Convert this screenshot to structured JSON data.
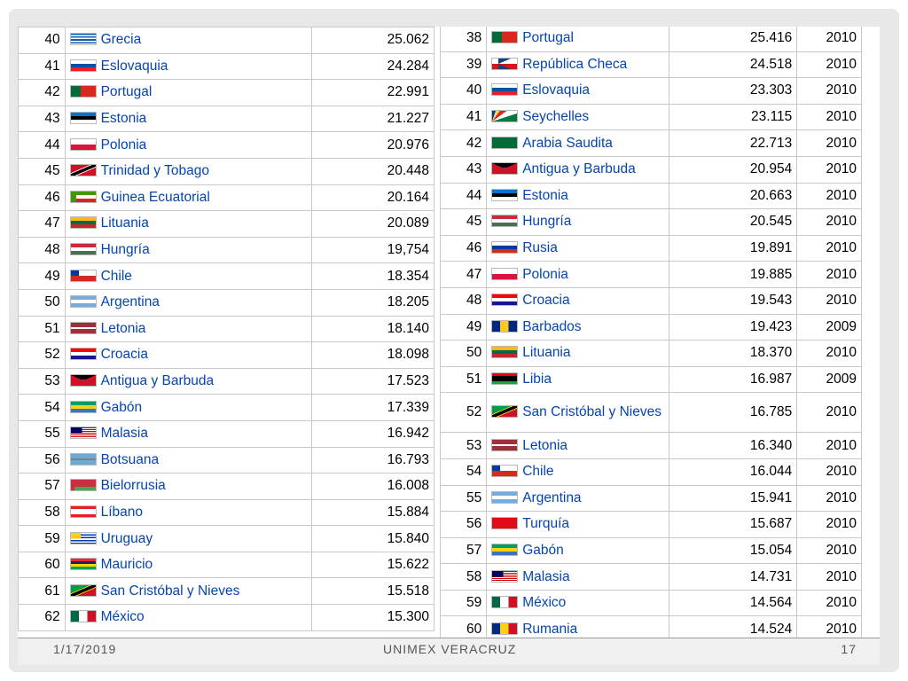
{
  "left_table": {
    "rows": [
      {
        "rank": "40",
        "flag": "gr",
        "country": "Grecia",
        "value": "25.062"
      },
      {
        "rank": "41",
        "flag": "sk",
        "country": "Eslovaquia",
        "value": "24.284"
      },
      {
        "rank": "42",
        "flag": "pt",
        "country": "Portugal",
        "value": "22.991"
      },
      {
        "rank": "43",
        "flag": "ee",
        "country": "Estonia",
        "value": "21.227"
      },
      {
        "rank": "44",
        "flag": "pl",
        "country": "Polonia",
        "value": "20.976"
      },
      {
        "rank": "45",
        "flag": "tt",
        "country": "Trinidad y Tobago",
        "value": "20.448"
      },
      {
        "rank": "46",
        "flag": "gq",
        "country": "Guinea Ecuatorial",
        "value": "20.164"
      },
      {
        "rank": "47",
        "flag": "lt",
        "country": "Lituania",
        "value": "20.089"
      },
      {
        "rank": "48",
        "flag": "hu",
        "country": "Hungría",
        "value": "19,754"
      },
      {
        "rank": "49",
        "flag": "cl",
        "country": "Chile",
        "value": "18.354"
      },
      {
        "rank": "50",
        "flag": "ar",
        "country": "Argentina",
        "value": "18.205"
      },
      {
        "rank": "51",
        "flag": "lv",
        "country": "Letonia",
        "value": "18.140"
      },
      {
        "rank": "52",
        "flag": "hr",
        "country": "Croacia",
        "value": "18.098"
      },
      {
        "rank": "53",
        "flag": "ag",
        "country": "Antigua y Barbuda",
        "value": "17.523"
      },
      {
        "rank": "54",
        "flag": "ga",
        "country": "Gabón",
        "value": "17.339"
      },
      {
        "rank": "55",
        "flag": "my",
        "country": "Malasia",
        "value": "16.942"
      },
      {
        "rank": "56",
        "flag": "bw",
        "country": "Botsuana",
        "value": "16.793"
      },
      {
        "rank": "57",
        "flag": "by",
        "country": "Bielorrusia",
        "value": "16.008"
      },
      {
        "rank": "58",
        "flag": "lb",
        "country": "Líbano",
        "value": "15.884"
      },
      {
        "rank": "59",
        "flag": "uy",
        "country": "Uruguay",
        "value": "15.840"
      },
      {
        "rank": "60",
        "flag": "mu",
        "country": "Mauricio",
        "value": "15.622"
      },
      {
        "rank": "61",
        "flag": "kn",
        "country": "San Cristóbal y Nieves",
        "value": "15.518"
      },
      {
        "rank": "62",
        "flag": "mx",
        "country": "México",
        "value": "15.300"
      }
    ]
  },
  "right_table": {
    "rows": [
      {
        "rank": "38",
        "flag": "pt",
        "country": "Portugal",
        "value": "25.416",
        "year": "2010"
      },
      {
        "rank": "39",
        "flag": "cz",
        "country": "República Checa",
        "value": "24.518",
        "year": "2010"
      },
      {
        "rank": "40",
        "flag": "sk",
        "country": "Eslovaquia",
        "value": "23.303",
        "year": "2010"
      },
      {
        "rank": "41",
        "flag": "sc",
        "country": "Seychelles",
        "value": "23.115",
        "year": "2010"
      },
      {
        "rank": "42",
        "flag": "sa",
        "country": "Arabia Saudita",
        "value": "22.713",
        "year": "2010"
      },
      {
        "rank": "43",
        "flag": "ag",
        "country": "Antigua y Barbuda",
        "value": "20.954",
        "year": "2010"
      },
      {
        "rank": "44",
        "flag": "ee",
        "country": "Estonia",
        "value": "20.663",
        "year": "2010"
      },
      {
        "rank": "45",
        "flag": "hu",
        "country": "Hungría",
        "value": "20.545",
        "year": "2010"
      },
      {
        "rank": "46",
        "flag": "ru",
        "country": "Rusia",
        "value": "19.891",
        "year": "2010"
      },
      {
        "rank": "47",
        "flag": "pl",
        "country": "Polonia",
        "value": "19.885",
        "year": "2010"
      },
      {
        "rank": "48",
        "flag": "hr",
        "country": "Croacia",
        "value": "19.543",
        "year": "2010"
      },
      {
        "rank": "49",
        "flag": "bb",
        "country": "Barbados",
        "value": "19.423",
        "year": "2009"
      },
      {
        "rank": "50",
        "flag": "lt",
        "country": "Lituania",
        "value": "18.370",
        "year": "2010"
      },
      {
        "rank": "51",
        "flag": "ly",
        "country": "Libia",
        "value": "16.987",
        "year": "2009"
      },
      {
        "rank": "52",
        "flag": "kn",
        "country": "San Cristóbal y Nieves",
        "value": "16.785",
        "year": "2010"
      },
      {
        "rank": "53",
        "flag": "lv",
        "country": "Letonia",
        "value": "16.340",
        "year": "2010"
      },
      {
        "rank": "54",
        "flag": "cl",
        "country": "Chile",
        "value": "16.044",
        "year": "2010"
      },
      {
        "rank": "55",
        "flag": "ar",
        "country": "Argentina",
        "value": "15.941",
        "year": "2010"
      },
      {
        "rank": "56",
        "flag": "tr",
        "country": "Turquía",
        "value": "15.687",
        "year": "2010"
      },
      {
        "rank": "57",
        "flag": "ga",
        "country": "Gabón",
        "value": "15.054",
        "year": "2010"
      },
      {
        "rank": "58",
        "flag": "my",
        "country": "Malasia",
        "value": "14.731",
        "year": "2010"
      },
      {
        "rank": "59",
        "flag": "mx",
        "country": "México",
        "value": "14.564",
        "year": "2010"
      },
      {
        "rank": "60",
        "flag": "ro",
        "country": "Rumania",
        "value": "14.524",
        "year": "2010"
      }
    ]
  },
  "footer": {
    "date": "1/17/2019",
    "title": "UNIMEX VERACRUZ",
    "page": "17"
  },
  "colors": {
    "link": "#0645ad",
    "border": "#c8c8c8",
    "frame": "#e8e8e8"
  }
}
